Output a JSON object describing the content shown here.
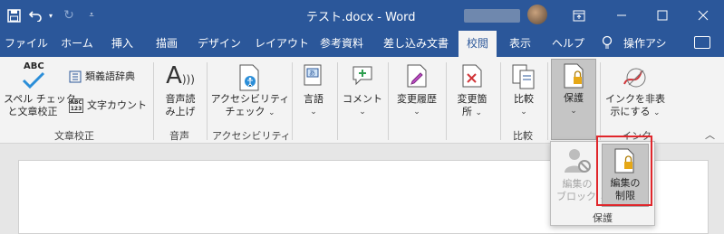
{
  "title_bar": {
    "document_title": "テスト.docx - Word",
    "qat_icons": [
      "save-icon",
      "undo-icon",
      "dropdown-icon",
      "redo-icon",
      "customize-icon"
    ],
    "window_icons": [
      "ribbon-display-icon",
      "minimize-icon",
      "maximize-icon",
      "close-icon"
    ]
  },
  "tabs": [
    {
      "label": "ファイル"
    },
    {
      "label": "ホーム"
    },
    {
      "label": "挿入"
    },
    {
      "label": "描画"
    },
    {
      "label": "デザイン"
    },
    {
      "label": "レイアウト"
    },
    {
      "label": "参考資料"
    },
    {
      "label": "差し込み文書"
    },
    {
      "label": "校閲",
      "active": true
    },
    {
      "label": "表示"
    },
    {
      "label": "ヘルプ"
    },
    {
      "label": "操作アシ"
    }
  ],
  "ribbon": {
    "proofing": {
      "spelling_icon_text": "ABC",
      "spelling_line1": "スペル チェック",
      "spelling_line2": "と文章校正",
      "thesaurus": "類義語辞典",
      "wordcount_icon_text": "ABC 123",
      "word_count": "文字カウント",
      "group": "文章校正"
    },
    "speech": {
      "read_aloud_line1": "音声読",
      "read_aloud_line2": "み上げ",
      "group": "音声"
    },
    "accessibility": {
      "check_line1": "アクセシビリティ",
      "check_line2": "チェック",
      "group": "アクセシビリティ"
    },
    "language": {
      "label": "言語"
    },
    "comments": {
      "label": "コメント"
    },
    "tracking": {
      "label": "変更履歴"
    },
    "changes": {
      "label_line1": "変更箇",
      "label_line2": "所"
    },
    "compare": {
      "label": "比較",
      "group": "比較"
    },
    "protect": {
      "label": "保護"
    },
    "ink": {
      "label_line1": "インクを非表",
      "label_line2": "示にする",
      "group": "インク"
    }
  },
  "protect_popup": {
    "block_authors_line1": "編集の",
    "block_authors_line2": "ブロック",
    "restrict_editing_line1": "編集の",
    "restrict_editing_line2": "制限",
    "group": "保護"
  },
  "colors": {
    "title_bar": "#2b579a",
    "ribbon": "#f3f3f3",
    "highlight": "#e0262b",
    "lock": "#e6a817"
  }
}
